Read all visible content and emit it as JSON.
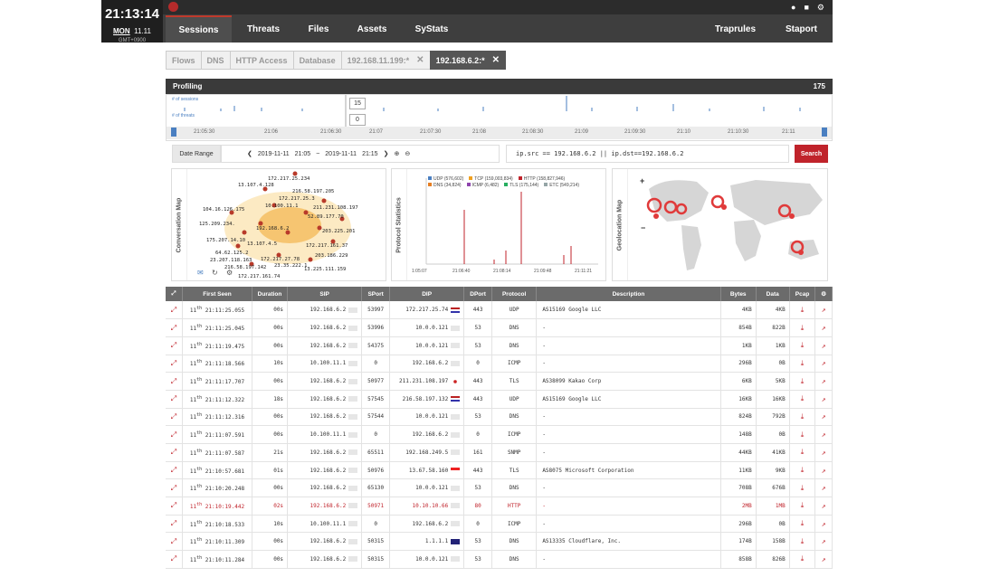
{
  "clock": {
    "time": "21:13:14",
    "day": "MON",
    "date": "11.11",
    "tz": "GMT+0900"
  },
  "nav": {
    "items": [
      "Sessions",
      "Threats",
      "Files",
      "Assets",
      "SyStats"
    ],
    "right": [
      "Traprules",
      "Staport"
    ]
  },
  "tabs": [
    "Flows",
    "DNS",
    "HTTP Access",
    "Database",
    "192.168.11.199:*",
    "192.168.6.2:*"
  ],
  "profiling": {
    "title": "Profiling",
    "count": "175",
    "sessions_label": "# of sessions",
    "threats_label": "# of threats",
    "sessions_val": "15",
    "threats_val": "0",
    "ticks": [
      "21:05:30",
      "21:06",
      "21:06:30",
      "21:07",
      "21:07:30",
      "21:08",
      "21:08:30",
      "21:09",
      "21:09:30",
      "21:10",
      "21:10:30",
      "21:11"
    ]
  },
  "filter": {
    "label": "Date Range",
    "from_date": "2019-11-11",
    "from_time": "21:05",
    "sep": "~",
    "to_date": "2019-11-11",
    "to_time": "21:15",
    "query": "ip.src == 192.168.6.2 || ip.dst==192.168.6.2",
    "search": "Search"
  },
  "panels": {
    "conv": "Conversation Map",
    "proto": "Protocol Statistics",
    "geo": "Geolocation Map",
    "conv_ips": [
      "172.217.25.234",
      "13.107.4.128",
      "216.58.197.205",
      "172.217.25.3",
      "104.16.126.175",
      "10.100.11.1",
      "52.89.177.70",
      "125.209.234.",
      "192.168.6.2",
      "203.225.201",
      "175.207.14.10",
      "13.107.4.5",
      "172.217.161.37",
      "64.62.125.2",
      "23.207.118.163",
      "172.217.27.78",
      "216.58.197.142",
      "23.35.222.1",
      "203.186.229",
      "172.217.161.74",
      "211.231.108.197",
      "13.225.111.159"
    ],
    "legend": [
      "UDP (576,602)",
      "TCP (159,003,834)",
      "HTTP (158,827,946)",
      "DNS (34,824)",
      "ICMP (6,482)",
      "TLS (175,144)",
      "ETC (549,214)"
    ],
    "proto_ticks": [
      "1:05:07",
      "21:06:40",
      "21:08:14",
      "21:09:48",
      "21:11:21"
    ]
  },
  "table": {
    "headers": [
      "",
      "First Seen",
      "Duration",
      "SIP",
      "SPort",
      "DIP",
      "DPort",
      "Protocol",
      "Description",
      "Bytes",
      "Data",
      "Pcap",
      ""
    ],
    "rows": [
      [
        "11",
        "21:11:25.055",
        "00s",
        "192.168.6.2",
        "53997",
        "172.217.25.74",
        "443",
        "UDP",
        "AS15169 Google LLC",
        "4KB",
        "4KB",
        "us"
      ],
      [
        "11",
        "21:11:25.045",
        "00s",
        "192.168.6.2",
        "53996",
        "10.0.0.121",
        "53",
        "DNS",
        "-",
        "854B",
        "822B",
        ""
      ],
      [
        "11",
        "21:11:19.475",
        "00s",
        "192.168.6.2",
        "54375",
        "10.0.0.121",
        "53",
        "DNS",
        "-",
        "1KB",
        "1KB",
        ""
      ],
      [
        "11",
        "21:11:18.566",
        "10s",
        "10.100.11.1",
        "0",
        "192.168.6.2",
        "0",
        "ICMP",
        "-",
        "296B",
        "0B",
        ""
      ],
      [
        "11",
        "21:11:17.707",
        "00s",
        "192.168.6.2",
        "50977",
        "211.231.108.197",
        "443",
        "TLS",
        "AS38099 Kakao Corp",
        "6KB",
        "5KB",
        "kr"
      ],
      [
        "11",
        "21:11:12.322",
        "18s",
        "192.168.6.2",
        "57545",
        "216.58.197.132",
        "443",
        "UDP",
        "AS15169 Google LLC",
        "16KB",
        "16KB",
        "us"
      ],
      [
        "11",
        "21:11:12.316",
        "00s",
        "192.168.6.2",
        "57544",
        "10.0.0.121",
        "53",
        "DNS",
        "-",
        "824B",
        "792B",
        ""
      ],
      [
        "11",
        "21:11:07.591",
        "00s",
        "10.100.11.1",
        "0",
        "192.168.6.2",
        "0",
        "ICMP",
        "-",
        "148B",
        "0B",
        ""
      ],
      [
        "11",
        "21:11:07.587",
        "21s",
        "192.168.6.2",
        "65511",
        "192.168.249.5",
        "161",
        "SNMP",
        "-",
        "44KB",
        "41KB",
        ""
      ],
      [
        "11",
        "21:10:57.681",
        "01s",
        "192.168.6.2",
        "50976",
        "13.67.58.160",
        "443",
        "TLS",
        "AS8075 Microsoft Corporation",
        "11KB",
        "9KB",
        "sg"
      ],
      [
        "11",
        "21:10:20.248",
        "00s",
        "192.168.6.2",
        "65130",
        "10.0.0.121",
        "53",
        "DNS",
        "-",
        "708B",
        "676B",
        ""
      ],
      [
        "11",
        "21:10:19.442",
        "02s",
        "192.168.6.2",
        "50971",
        "10.10.10.66",
        "80",
        "HTTP",
        "-",
        "2MB",
        "1MB",
        ""
      ],
      [
        "11",
        "21:10:18.533",
        "10s",
        "10.100.11.1",
        "0",
        "192.168.6.2",
        "0",
        "ICMP",
        "-",
        "296B",
        "0B",
        ""
      ],
      [
        "11",
        "21:10:11.309",
        "00s",
        "192.168.6.2",
        "50315",
        "1.1.1.1",
        "53",
        "DNS",
        "AS13335 Cloudflare, Inc.",
        "174B",
        "158B",
        "au"
      ],
      [
        "11",
        "21:10:11.284",
        "00s",
        "192.168.6.2",
        "50315",
        "10.0.0.121",
        "53",
        "DNS",
        "-",
        "858B",
        "826B",
        ""
      ]
    ]
  }
}
